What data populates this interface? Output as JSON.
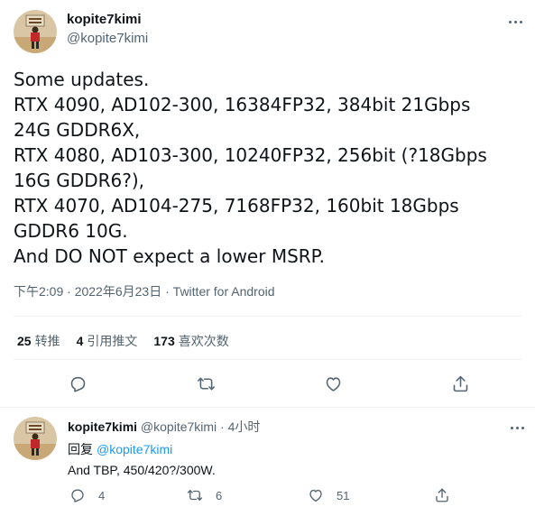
{
  "main_tweet": {
    "display_name": "kopite7kimi",
    "handle": "@kopite7kimi",
    "text_lines": [
      "Some updates.",
      "RTX 4090, AD102-300, 16384FP32, 384bit 21Gbps",
      "24G GDDR6X,",
      "RTX 4080, AD103-300, 10240FP32, 256bit (?18Gbps",
      "16G GDDR6?),",
      "RTX 4070, AD104-275, 7168FP32, 160bit 18Gbps",
      "GDDR6 10G.",
      "And DO NOT expect a lower MSRP."
    ],
    "time": "下午2:09",
    "date": "2022年6月23日",
    "separator": " · ",
    "source": "Twitter for Android",
    "stats": {
      "retweets_count": "25",
      "retweets_label": "转推",
      "quotes_count": "4",
      "quotes_label": "引用推文",
      "likes_count": "173",
      "likes_label": "喜欢次数"
    }
  },
  "reply_tweet": {
    "display_name": "kopite7kimi",
    "handle": "@kopite7kimi",
    "dot": " · ",
    "time": "4小时",
    "replying_label": "回复",
    "replying_to": "@kopite7kimi",
    "text": "And TBP, 450/420?/300W.",
    "reply_count": "4",
    "retweet_count": "6",
    "like_count": "51"
  },
  "icons": {
    "reply": "reply-icon",
    "retweet": "retweet-icon",
    "like": "heart-icon",
    "share": "share-icon",
    "more": "more-icon"
  },
  "colors": {
    "text": "#0f1419",
    "secondary": "#536471",
    "link": "#1d9bf0",
    "divider": "#eff3f4"
  }
}
